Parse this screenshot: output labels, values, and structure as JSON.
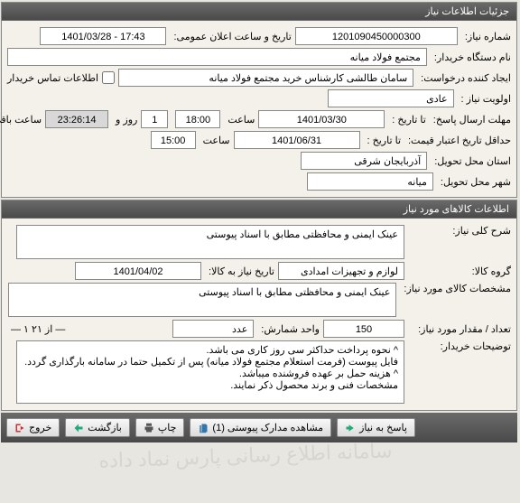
{
  "panels": {
    "info": {
      "title": "جزئیات اطلاعات نیاز"
    },
    "items": {
      "title": "اطلاعات کالاهای مورد نیاز"
    }
  },
  "info": {
    "need_no_label": "شماره نیاز:",
    "need_no": "1201090450000300",
    "public_announce_label": "تاریخ و ساعت اعلان عمومی:",
    "public_announce": "17:43 - 1401/03/28",
    "buyer_label": "نام دستگاه خریدار:",
    "buyer": "مجتمع فولاد میانه",
    "requester_label": "ایجاد کننده درخواست:",
    "requester": "سامان طالشی کارشناس خرید مجتمع فولاد میانه",
    "contact_chk_label": "اطلاعات تماس خریدار",
    "priority_label": "اولویت نیاز :",
    "priority": "عادی",
    "deadline_label": "مهلت ارسال پاسخ:",
    "to_date_label": "تا تاریخ :",
    "deadline_date": "1401/03/30",
    "time_label": "ساعت",
    "deadline_time": "18:00",
    "days": "1",
    "days_and": "روز و",
    "remain": "23:26:14",
    "remain_suffix": "ساعت باقی مانده",
    "validity_label": "حداقل تاریخ اعتبار قیمت:",
    "validity_date": "1401/06/31",
    "validity_time": "15:00",
    "province_label": "استان محل تحویل:",
    "province": "آذربایجان شرقی",
    "city_label": "شهر محل تحویل:",
    "city": "میانه"
  },
  "items": {
    "overall_label": "شرح کلی نیاز:",
    "overall": "عینک ایمنی و محافظتی مطابق با اسناد پیوستی",
    "group_label": "گروه کالا:",
    "group": "لوازم و تجهیزات امدادی",
    "need_date_label": "تاریخ نیاز به کالا:",
    "need_date": "1401/04/02",
    "spec_label": "مشخصات کالای مورد نیاز:",
    "spec": "عینک ایمنی و محافظتی مطابق با اسناد پیوستی",
    "qty_label": "تعداد / مقدار مورد نیاز:",
    "qty": "150",
    "unit_label": "واحد شمارش:",
    "unit": "عدد",
    "pager": "— ۱ از ۲۱ —",
    "buyer_notes_label": "توضیحات خریدار:",
    "buyer_notes": "^ نحوه پرداخت حداکثر سی روز کاری می باشد.\nفایل پیوست (فرمت استعلام مجتمع فولاد میانه) پس از تکمیل حتما در سامانه بارگذاری گردد.\n^ هزینه حمل بر عهده فروشنده میباشد.\nمشخصات فنی و برند محصول ذکر نمایند."
  },
  "buttons": {
    "exit": "خروج",
    "back": "بازگشت",
    "print": "چاپ",
    "attachments": "مشاهده مدارک پیوستی (1)",
    "respond": "پاسخ به نیاز"
  },
  "watermark": "سامانه اطلاع رسانی پارس نماد داده"
}
